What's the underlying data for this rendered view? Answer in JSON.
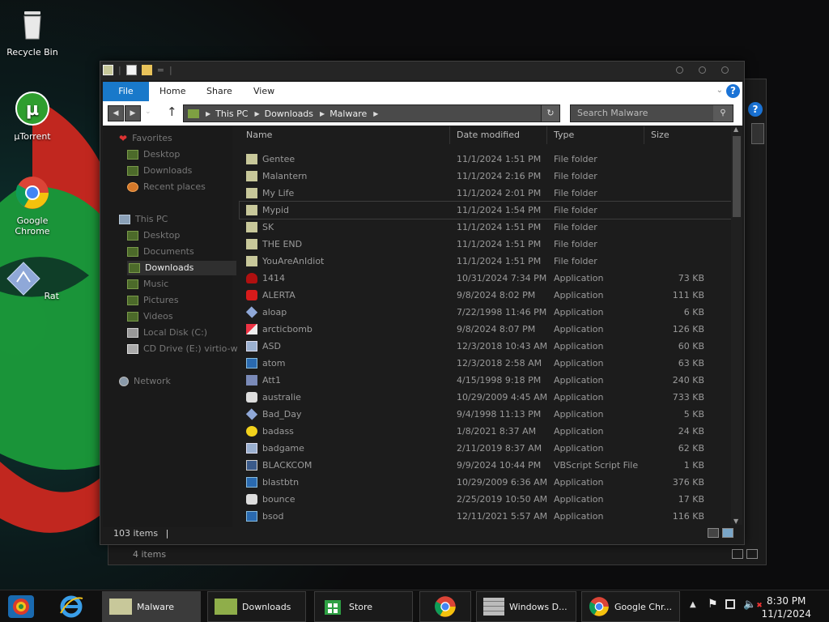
{
  "desktop": {
    "icons": [
      {
        "label": "Recycle Bin"
      },
      {
        "label": "µTorrent"
      },
      {
        "label": "Google Chrome"
      },
      {
        "label": "Rat"
      }
    ]
  },
  "back_window": {
    "status": "4 items",
    "help": "?"
  },
  "window": {
    "ribbon_tabs": [
      "File",
      "Home",
      "Share",
      "View"
    ],
    "help": "?",
    "breadcrumb": [
      "This PC",
      "Downloads",
      "Malware"
    ],
    "search_placeholder": "Search Malware",
    "status": "103 items",
    "nav_pane": {
      "favorites": {
        "label": "Favorites",
        "items": [
          "Desktop",
          "Downloads",
          "Recent places"
        ]
      },
      "this_pc": {
        "label": "This PC",
        "items": [
          "Desktop",
          "Documents",
          "Downloads",
          "Music",
          "Pictures",
          "Videos",
          "Local Disk (C:)",
          "CD Drive (E:) virtio-w"
        ]
      },
      "network": {
        "label": "Network"
      },
      "selected": "Downloads"
    },
    "columns": [
      "Name",
      "Date modified",
      "Type",
      "Size"
    ],
    "files": [
      {
        "name": "Gentee",
        "date": "11/1/2024 1:51 PM",
        "type": "File folder",
        "size": "",
        "icon": "folder-icon"
      },
      {
        "name": "Malantern",
        "date": "11/1/2024 2:16 PM",
        "type": "File folder",
        "size": "",
        "icon": "folder-icon"
      },
      {
        "name": "My Life",
        "date": "11/1/2024 2:01 PM",
        "type": "File folder",
        "size": "",
        "icon": "folder-icon"
      },
      {
        "name": "Mypid",
        "date": "11/1/2024 1:54 PM",
        "type": "File folder",
        "size": "",
        "icon": "folder-icon"
      },
      {
        "name": "SK",
        "date": "11/1/2024 1:51 PM",
        "type": "File folder",
        "size": "",
        "icon": "folder-icon"
      },
      {
        "name": "THE END",
        "date": "11/1/2024 1:51 PM",
        "type": "File folder",
        "size": "",
        "icon": "folder-icon"
      },
      {
        "name": "YouAreAnIdiot",
        "date": "11/1/2024 1:51 PM",
        "type": "File folder",
        "size": "",
        "icon": "folder-icon"
      },
      {
        "name": "1414",
        "date": "10/31/2024 7:34 PM",
        "type": "Application",
        "size": "73 KB",
        "icon": "skull-icon"
      },
      {
        "name": "ALERTA",
        "date": "9/8/2024 8:02 PM",
        "type": "Application",
        "size": "111 KB",
        "icon": "stop-sign-icon"
      },
      {
        "name": "aloap",
        "date": "7/22/1998 11:46 PM",
        "type": "Application",
        "size": "6 KB",
        "icon": "diamond-icon"
      },
      {
        "name": "arcticbomb",
        "date": "9/8/2024 8:07 PM",
        "type": "Application",
        "size": "126 KB",
        "icon": "bomb-icon"
      },
      {
        "name": "ASD",
        "date": "12/3/2018 10:43 AM",
        "type": "Application",
        "size": "60 KB",
        "icon": "computer-icon"
      },
      {
        "name": "atom",
        "date": "12/3/2018 2:58 AM",
        "type": "Application",
        "size": "63 KB",
        "icon": "window-icon"
      },
      {
        "name": "Att1",
        "date": "4/15/1998 9:18 PM",
        "type": "Application",
        "size": "240 KB",
        "icon": "app-icon"
      },
      {
        "name": "australie",
        "date": "10/29/2009 4:45 AM",
        "type": "Application",
        "size": "733 KB",
        "icon": "face-icon"
      },
      {
        "name": "Bad_Day",
        "date": "9/4/1998 11:13 PM",
        "type": "Application",
        "size": "5 KB",
        "icon": "diamond-icon"
      },
      {
        "name": "badass",
        "date": "1/8/2021 8:37 AM",
        "type": "Application",
        "size": "24 KB",
        "icon": "smiley-icon"
      },
      {
        "name": "badgame",
        "date": "2/11/2019 8:37 AM",
        "type": "Application",
        "size": "62 KB",
        "icon": "computer-icon"
      },
      {
        "name": "BLACKCOM",
        "date": "9/9/2024 10:44 PM",
        "type": "VBScript Script File",
        "size": "1 KB",
        "icon": "script-icon"
      },
      {
        "name": "blastbtn",
        "date": "10/29/2009 6:36 AM",
        "type": "Application",
        "size": "376 KB",
        "icon": "window-icon"
      },
      {
        "name": "bounce",
        "date": "2/25/2019 10:50 AM",
        "type": "Application",
        "size": "17 KB",
        "icon": "face-icon"
      },
      {
        "name": "bsod",
        "date": "12/11/2021 5:57 AM",
        "type": "Application",
        "size": "116 KB",
        "icon": "window-icon"
      }
    ]
  },
  "taskbar": {
    "items": [
      "Malware",
      "Downloads",
      "Store",
      "Windows D...",
      "Google Chr..."
    ],
    "time": "8:30 PM",
    "date": "11/1/2024"
  },
  "colors": {
    "ribbon_file_tab": "#1979ca",
    "help_button": "#1a73d6",
    "folder": "#c8c89a",
    "utorrent": "#2f9e2f",
    "desktop_green": "#1b9a3a",
    "desktop_red": "#c1271f"
  }
}
